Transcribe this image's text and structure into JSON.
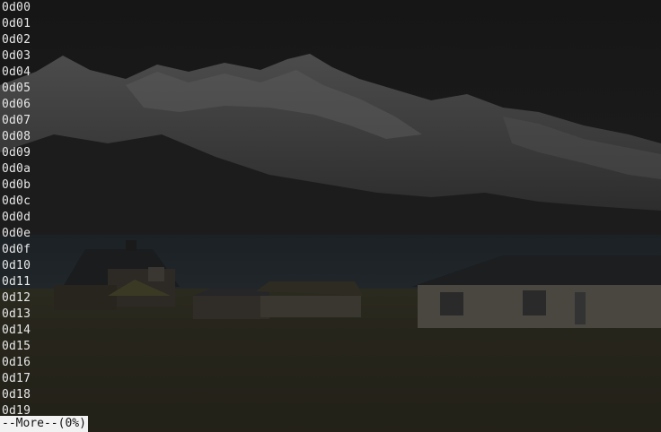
{
  "terminal": {
    "lines": [
      "0d00",
      "0d01",
      "0d02",
      "0d03",
      "0d04",
      "0d05",
      "0d06",
      "0d07",
      "0d08",
      "0d09",
      "0d0a",
      "0d0b",
      "0d0c",
      "0d0d",
      "0d0e",
      "0d0f",
      "0d10",
      "0d11",
      "0d12",
      "0d13",
      "0d14",
      "0d15",
      "0d16",
      "0d17",
      "0d18",
      "0d19"
    ],
    "pager_prompt": "--More--(0%)"
  },
  "colors": {
    "text": "#e8e8e8",
    "prompt_bg": "#f2f2f2",
    "prompt_fg": "#141414"
  }
}
